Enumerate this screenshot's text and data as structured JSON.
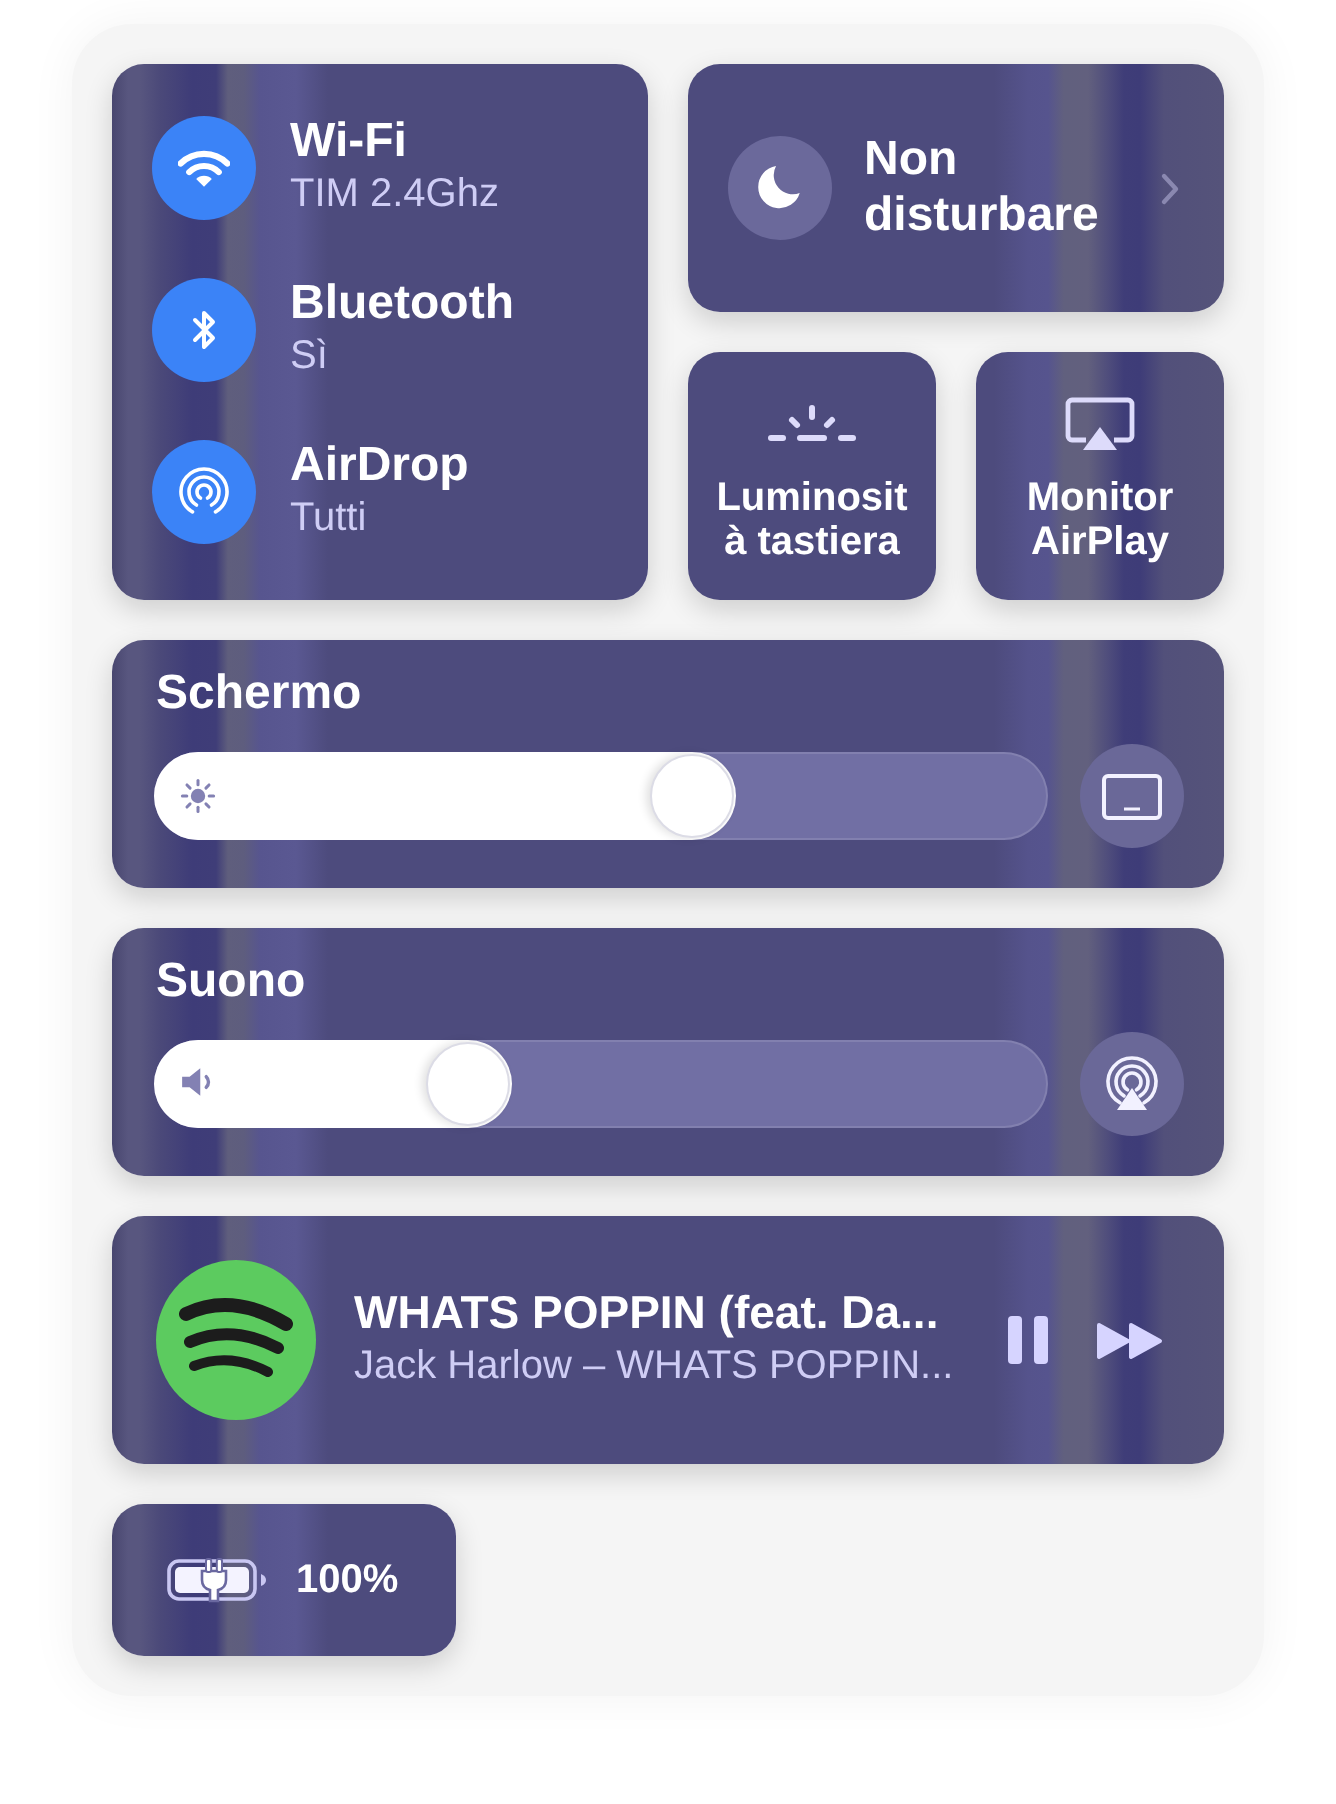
{
  "connectivity": [
    {
      "title": "Wi-Fi",
      "status": "TIM 2.4Ghz",
      "on": true
    },
    {
      "title": "Bluetooth",
      "status": "Sì",
      "on": true
    },
    {
      "title": "AirDrop",
      "status": "Tutti",
      "on": true
    }
  ],
  "do_not_disturb": {
    "label": "Non disturbare",
    "on": false
  },
  "tiles": [
    {
      "label": "Luminosit\nà tastiera"
    },
    {
      "label": "Monitor AirPlay"
    }
  ],
  "sliders": [
    {
      "title": "Schermo",
      "level": 0.65
    },
    {
      "title": "Suono",
      "level": 0.4
    }
  ],
  "now_playing": {
    "title": "WHATS POPPIN (feat. Da...",
    "subtitle": "Jack Harlow – WHATS POPPIN...",
    "playing": true
  },
  "battery": {
    "percentage": "100%"
  }
}
